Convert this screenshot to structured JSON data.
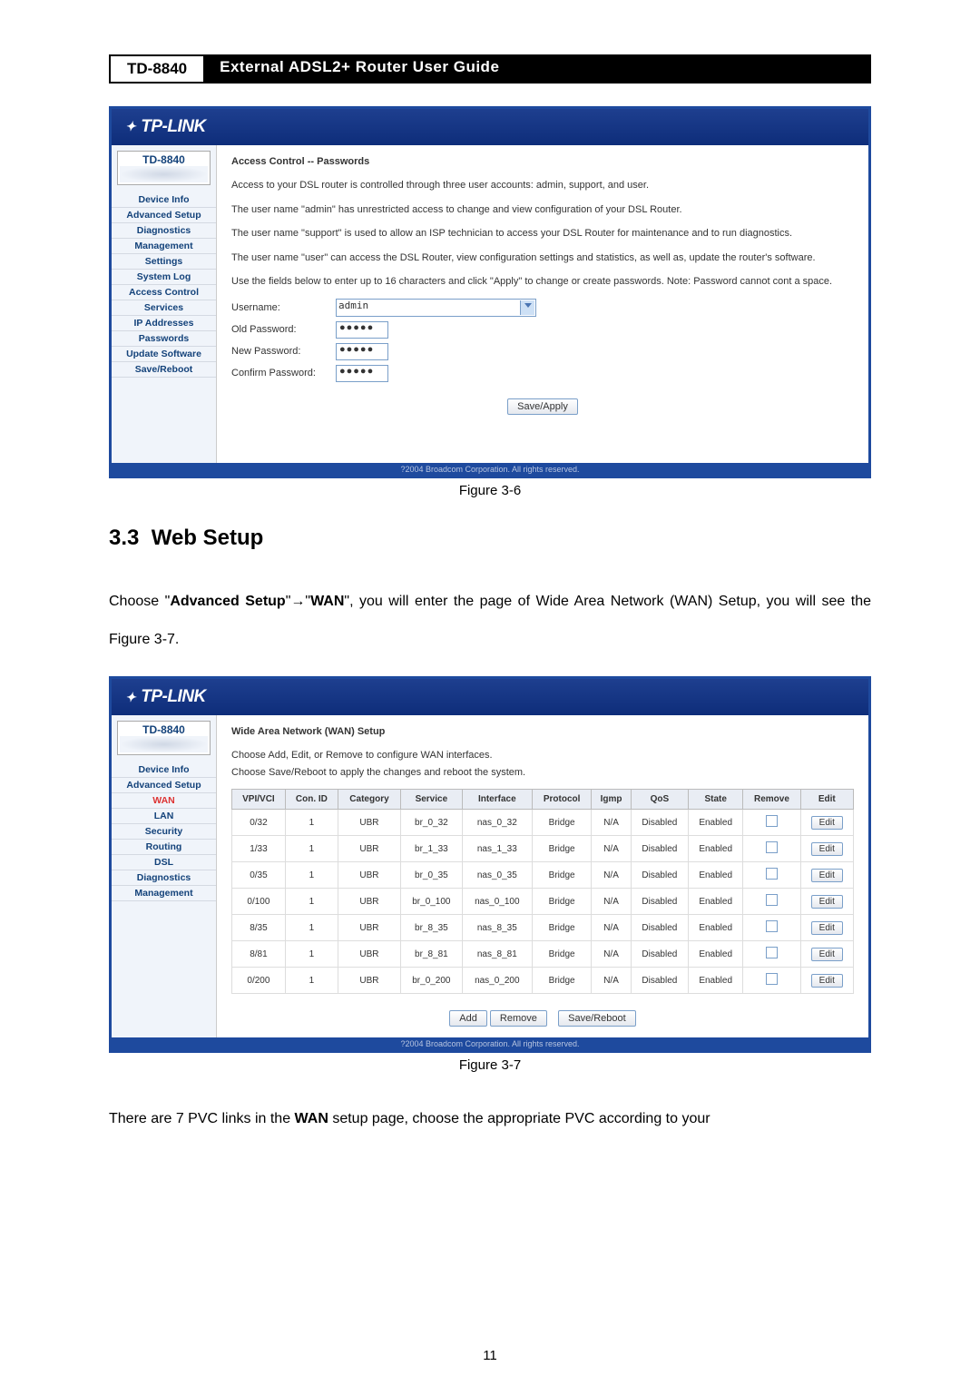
{
  "header": {
    "model": "TD-8840",
    "title": "External ADSL2+ Router User Guide"
  },
  "fig1": {
    "logo": "TP-LINK",
    "device": "TD-8840",
    "nav": [
      "Device Info",
      "Advanced Setup",
      "Diagnostics",
      "Management",
      "Settings",
      "System Log",
      "Access Control",
      "Services",
      "IP Addresses",
      "Passwords",
      "Update Software",
      "Save/Reboot"
    ],
    "title": "Access Control -- Passwords",
    "p1": "Access to your DSL router is controlled through three user accounts: admin, support, and user.",
    "p2": "The user name \"admin\" has unrestricted access to change and view configuration of your DSL Router.",
    "p3": "The user name \"support\" is used to allow an ISP technician to access your DSL Router for maintenance and to run diagnostics.",
    "p4": "The user name \"user\" can access the DSL Router, view configuration settings and statistics, as well as, update the router's software.",
    "p5": "Use the fields below to enter up to 16 characters and click \"Apply\" to change or create passwords. Note: Password cannot cont a space.",
    "labels": {
      "user": "Username:",
      "old": "Old Password:",
      "new": "New Password:",
      "conf": "Confirm Password:"
    },
    "username": "admin",
    "mask": "●●●●●",
    "apply": "Save/Apply",
    "footer": "?2004 Broadcom Corporation. All rights reserved.",
    "caption": "Figure 3-6"
  },
  "sect": {
    "num": "3.3",
    "title": "Web Setup"
  },
  "body1a": "Choose \"",
  "body1b": "Advanced Setup",
  "body1c": "\"→\"",
  "body1d": "WAN",
  "body1e": "\", you will enter the page of Wide Area Network (WAN) Setup, you will see the Figure 3-7.",
  "fig2": {
    "logo": "TP-LINK",
    "device": "TD-8840",
    "nav": [
      "Device Info",
      "Advanced Setup",
      "WAN",
      "LAN",
      "Security",
      "Routing",
      "DSL",
      "Diagnostics",
      "Management"
    ],
    "navActive": "WAN",
    "title": "Wide Area Network (WAN) Setup",
    "sub1": "Choose Add, Edit, or Remove to configure WAN interfaces.",
    "sub2": "Choose Save/Reboot to apply the changes and reboot the system.",
    "headers": [
      "VPI/VCI",
      "Con. ID",
      "Category",
      "Service",
      "Interface",
      "Protocol",
      "Igmp",
      "QoS",
      "State",
      "Remove",
      "Edit"
    ],
    "rows": [
      {
        "vpi": "0/32",
        "con": "1",
        "cat": "UBR",
        "srv": "br_0_32",
        "if": "nas_0_32",
        "pr": "Bridge",
        "ig": "N/A",
        "qos": "Disabled",
        "st": "Enabled"
      },
      {
        "vpi": "1/33",
        "con": "1",
        "cat": "UBR",
        "srv": "br_1_33",
        "if": "nas_1_33",
        "pr": "Bridge",
        "ig": "N/A",
        "qos": "Disabled",
        "st": "Enabled"
      },
      {
        "vpi": "0/35",
        "con": "1",
        "cat": "UBR",
        "srv": "br_0_35",
        "if": "nas_0_35",
        "pr": "Bridge",
        "ig": "N/A",
        "qos": "Disabled",
        "st": "Enabled"
      },
      {
        "vpi": "0/100",
        "con": "1",
        "cat": "UBR",
        "srv": "br_0_100",
        "if": "nas_0_100",
        "pr": "Bridge",
        "ig": "N/A",
        "qos": "Disabled",
        "st": "Enabled"
      },
      {
        "vpi": "8/35",
        "con": "1",
        "cat": "UBR",
        "srv": "br_8_35",
        "if": "nas_8_35",
        "pr": "Bridge",
        "ig": "N/A",
        "qos": "Disabled",
        "st": "Enabled"
      },
      {
        "vpi": "8/81",
        "con": "1",
        "cat": "UBR",
        "srv": "br_8_81",
        "if": "nas_8_81",
        "pr": "Bridge",
        "ig": "N/A",
        "qos": "Disabled",
        "st": "Enabled"
      },
      {
        "vpi": "0/200",
        "con": "1",
        "cat": "UBR",
        "srv": "br_0_200",
        "if": "nas_0_200",
        "pr": "Bridge",
        "ig": "N/A",
        "qos": "Disabled",
        "st": "Enabled"
      }
    ],
    "edit": "Edit",
    "add": "Add",
    "remove": "Remove",
    "save": "Save/Reboot",
    "footer": "?2004 Broadcom Corporation. All rights reserved.",
    "caption": "Figure 3-7"
  },
  "body2a": "There are 7 PVC links in the ",
  "body2b": "WAN",
  "body2c": " setup page, choose the appropriate PVC according to your",
  "pagenum": "11"
}
